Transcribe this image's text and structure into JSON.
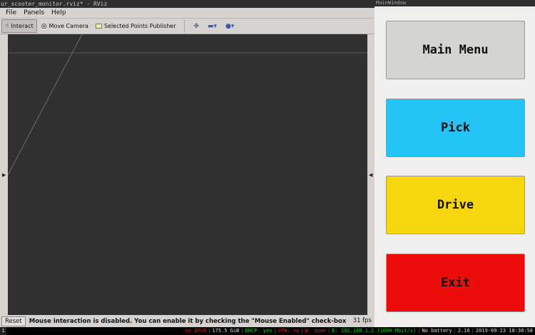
{
  "rviz": {
    "window_title": "ur_scooter_monitor.rviz* - RViz",
    "menus": [
      "File",
      "Panels",
      "Help"
    ],
    "tools": {
      "interact": "Interact",
      "move_camera": "Move Camera",
      "selected_points": "Selected Points Publisher"
    },
    "status": {
      "reset": "Reset",
      "message": "Mouse interaction is disabled. You can enable it by checking the \"Mouse Enabled\" check-box in the View",
      "fps": "31 fps"
    }
  },
  "main_window": {
    "title": "MainWindow",
    "buttons": [
      {
        "label": "Main Menu",
        "color": "#d4d5d1"
      },
      {
        "label": "Pick",
        "color": "#25c4f7"
      },
      {
        "label": "Drive",
        "color": "#f6d70d"
      },
      {
        "label": "Exit",
        "color": "#ec0c0a"
      }
    ]
  },
  "taskbar": {
    "workspace": "1",
    "ipv6": "no IPv6",
    "disk": "175.5 GiB",
    "dhcp": "DHCP: yes",
    "vpn": "VPN: no",
    "wifi": "W: down",
    "ethernet": "E: 192.168.1.2 (1000 Mbit/s)",
    "battery": "No battery",
    "load": "2.16",
    "datetime": "2019-09-23 18:30:58"
  }
}
